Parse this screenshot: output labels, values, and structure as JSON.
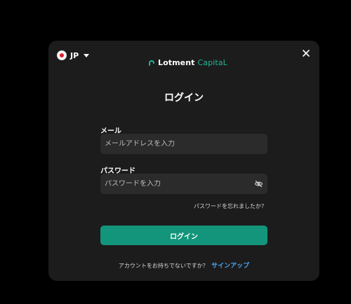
{
  "language": {
    "code": "JP",
    "flag": "japan-flag-icon"
  },
  "brand": {
    "name_main": "Lotment",
    "name_accent": "CapitaL",
    "accent_color": "#23b596"
  },
  "login": {
    "title": "ログイン",
    "email_label": "メール",
    "email_placeholder": "メールアドレスを入力",
    "password_label": "パスワード",
    "password_placeholder": "パスワードを入力",
    "forgot_password": "パスワードを忘れましたか？",
    "submit_label": "ログイン",
    "submit_color": "#13957b"
  },
  "signup": {
    "prompt": "アカウントをお持ちでないですか？",
    "link": "サインアップ",
    "link_color": "#4aa3f0"
  }
}
